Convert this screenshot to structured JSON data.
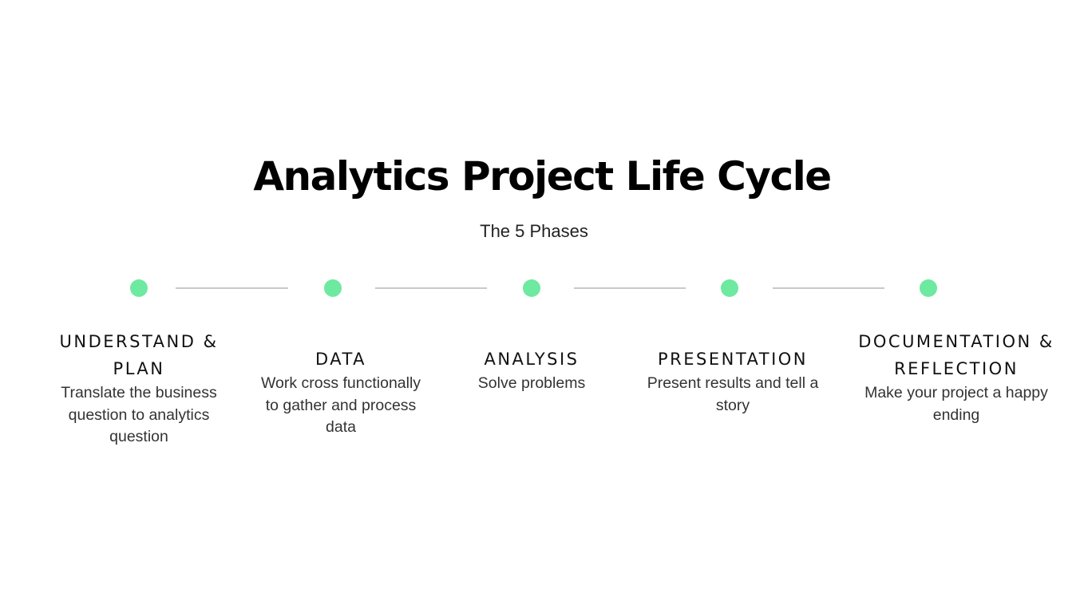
{
  "title": "Analytics Project Life Cycle",
  "subtitle": "The 5 Phases",
  "accent_color": "#6ee9a0",
  "connector_color": "#c9c9c9",
  "phases": [
    {
      "title": "UNDERSTAND & PLAN",
      "description": "Translate the business question to analytics question"
    },
    {
      "title": "DATA",
      "description": "Work cross functionally to gather and process data"
    },
    {
      "title": "ANALYSIS",
      "description": "Solve problems"
    },
    {
      "title": "PRESENTATION",
      "description": "Present results and tell a story"
    },
    {
      "title": "DOCUMENTATION & REFLECTION",
      "description": "Make your project a happy ending"
    }
  ]
}
